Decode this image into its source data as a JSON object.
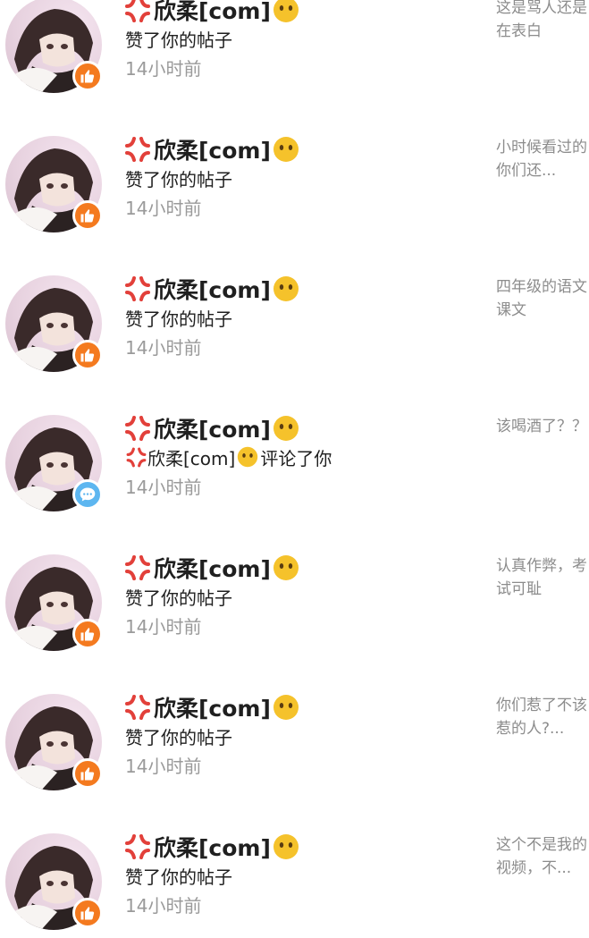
{
  "notifications": [
    {
      "user": "欣柔[com]",
      "action": "赞了你的帖子",
      "time": "14小时前",
      "type": "like",
      "snippet": "这是骂人还是在表白"
    },
    {
      "user": "欣柔[com]",
      "action": "赞了你的帖子",
      "time": "14小时前",
      "type": "like",
      "snippet": "小时候看过的你们还..."
    },
    {
      "user": "欣柔[com]",
      "action": "赞了你的帖子",
      "time": "14小时前",
      "type": "like",
      "snippet": "四年级的语文课文"
    },
    {
      "user": "欣柔[com]",
      "action_user": "欣柔[com]",
      "action": "评论了你",
      "time": "14小时前",
      "type": "comment",
      "snippet": "该喝酒了？？"
    },
    {
      "user": "欣柔[com]",
      "action": "赞了你的帖子",
      "time": "14小时前",
      "type": "like",
      "snippet": "认真作弊，考试可耻"
    },
    {
      "user": "欣柔[com]",
      "action": "赞了你的帖子",
      "time": "14小时前",
      "type": "like",
      "snippet": "你们惹了不该惹的人?..."
    },
    {
      "user": "欣柔[com]",
      "action": "赞了你的帖子",
      "time": "14小时前",
      "type": "like",
      "snippet": "这个不是我的视频，不..."
    }
  ],
  "icons": {
    "like_badge": "thumbs-up-icon",
    "comment_badge": "chat-bubble-icon",
    "name_prefix": "anger-symbol-icon",
    "name_suffix": "no-mouth-face-icon"
  },
  "colors": {
    "like_badge": "#f47a1f",
    "comment_badge": "#5db6f0",
    "anger": "#e2403a",
    "smiley": "#f5c22b",
    "time_text": "#9a9a9a",
    "snippet_text": "#8c8c8c"
  }
}
